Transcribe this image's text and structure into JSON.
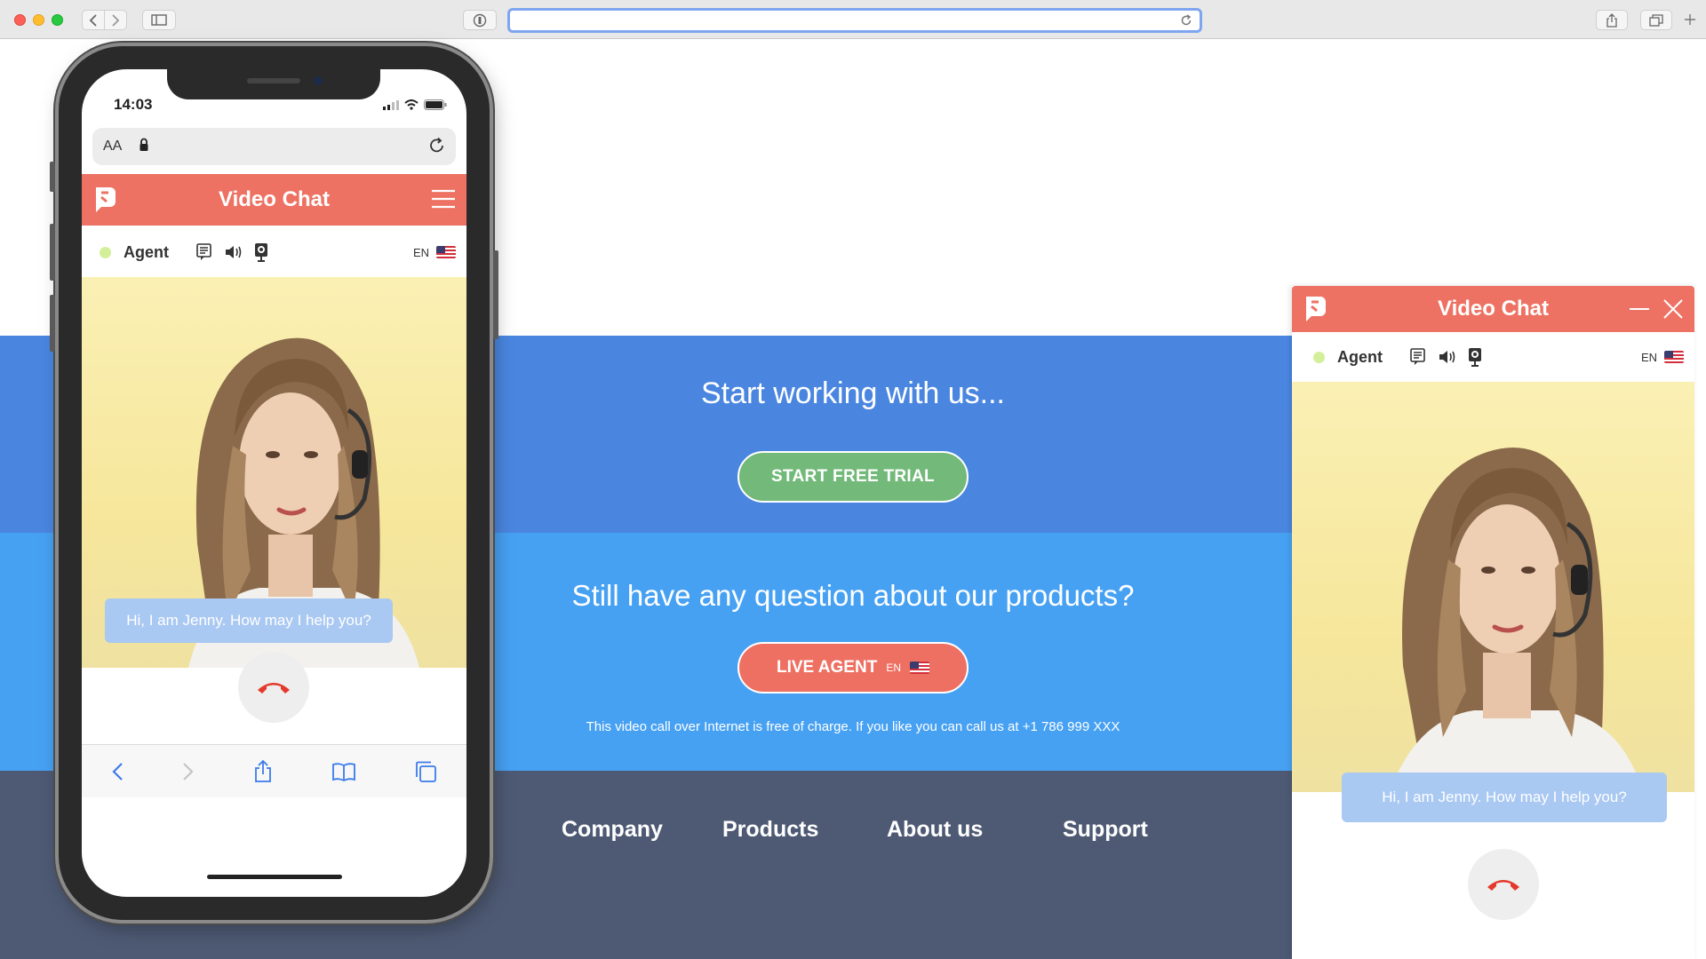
{
  "browser": {
    "url": "",
    "icons": [
      "back-icon",
      "forward-icon",
      "sidebar-icon",
      "privacy-icon",
      "reload-icon",
      "share-icon",
      "tabs-icon",
      "new-tab-icon"
    ]
  },
  "hero": {
    "cta_title": "Start working with us...",
    "trial_button": "START FREE TRIAL",
    "question": "Still have any question about our products?",
    "agent_button": "LIVE AGENT",
    "agent_lang": "EN",
    "note": "This video call over Internet is free of charge. If you like you can call us at +1 786 999 XXX"
  },
  "footer": {
    "links": [
      "Company",
      "Products",
      "About us",
      "Support"
    ]
  },
  "phone": {
    "time": "14:03",
    "address_aa": "AA",
    "chat": {
      "title": "Video Chat",
      "agent": "Agent",
      "lang": "EN",
      "message": "Hi, I am Jenny. How may I help you?"
    }
  },
  "widget": {
    "title": "Video Chat",
    "agent": "Agent",
    "lang": "EN",
    "message": "Hi, I am Jenny. How may I help you?"
  },
  "colors": {
    "brand": "#ee7263",
    "band_top": "#4a86e0",
    "band_mid": "#47a1f3",
    "footer": "#4e5a74",
    "trial_green": "#72b97a",
    "online": "#d4ef9a"
  }
}
